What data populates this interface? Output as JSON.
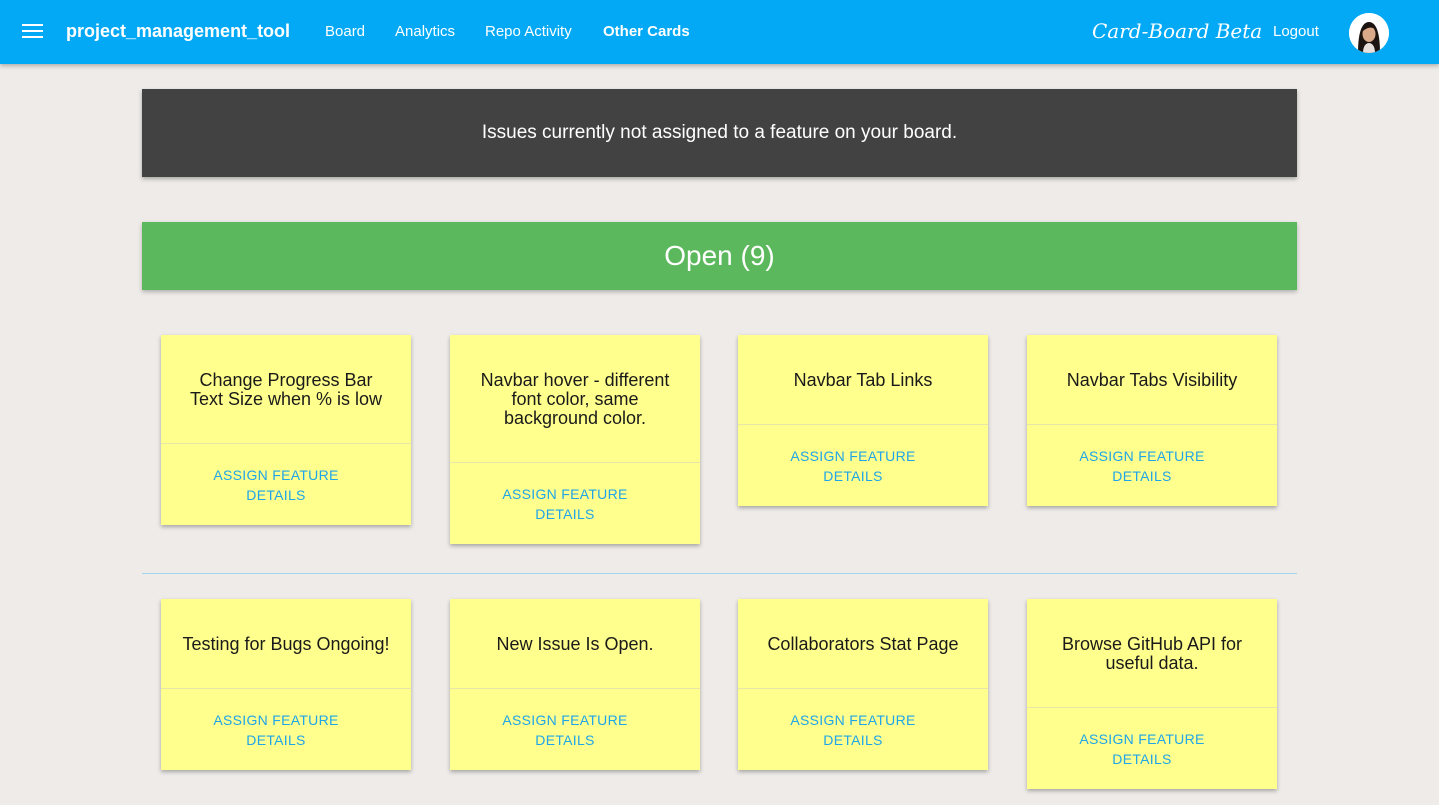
{
  "navbar": {
    "brand": "project_management_tool",
    "links": [
      {
        "label": "Board",
        "active": false
      },
      {
        "label": "Analytics",
        "active": false
      },
      {
        "label": "Repo Activity",
        "active": false
      },
      {
        "label": "Other Cards",
        "active": true
      }
    ],
    "app_title": "Card-Board Beta",
    "logout_label": "Logout",
    "accent_color": "#03a9f4"
  },
  "banner": {
    "text": "Issues currently not assigned to a feature on your board."
  },
  "status_header": {
    "label": "Open (9)",
    "color": "#5cb85c"
  },
  "cards": [
    {
      "title": "Change Progress Bar Text Size when % is low",
      "assign_label": "ASSIGN FEATURE",
      "details_label": "DETAILS"
    },
    {
      "title": "Navbar hover - different font color, same background color.",
      "assign_label": "ASSIGN FEATURE",
      "details_label": "DETAILS"
    },
    {
      "title": "Navbar Tab Links",
      "assign_label": "ASSIGN FEATURE",
      "details_label": "DETAILS"
    },
    {
      "title": "Navbar Tabs Visibility",
      "assign_label": "ASSIGN FEATURE",
      "details_label": "DETAILS"
    },
    {
      "title": "Testing for Bugs Ongoing!",
      "assign_label": "ASSIGN FEATURE",
      "details_label": "DETAILS"
    },
    {
      "title": "New Issue Is Open.",
      "assign_label": "ASSIGN FEATURE",
      "details_label": "DETAILS"
    },
    {
      "title": "Collaborators Stat Page",
      "assign_label": "ASSIGN FEATURE",
      "details_label": "DETAILS"
    },
    {
      "title": "Browse GitHub API for useful data.",
      "assign_label": "ASSIGN FEATURE",
      "details_label": "DETAILS"
    }
  ],
  "card_color": "#ffff8d",
  "link_color": "#1fa5e8"
}
